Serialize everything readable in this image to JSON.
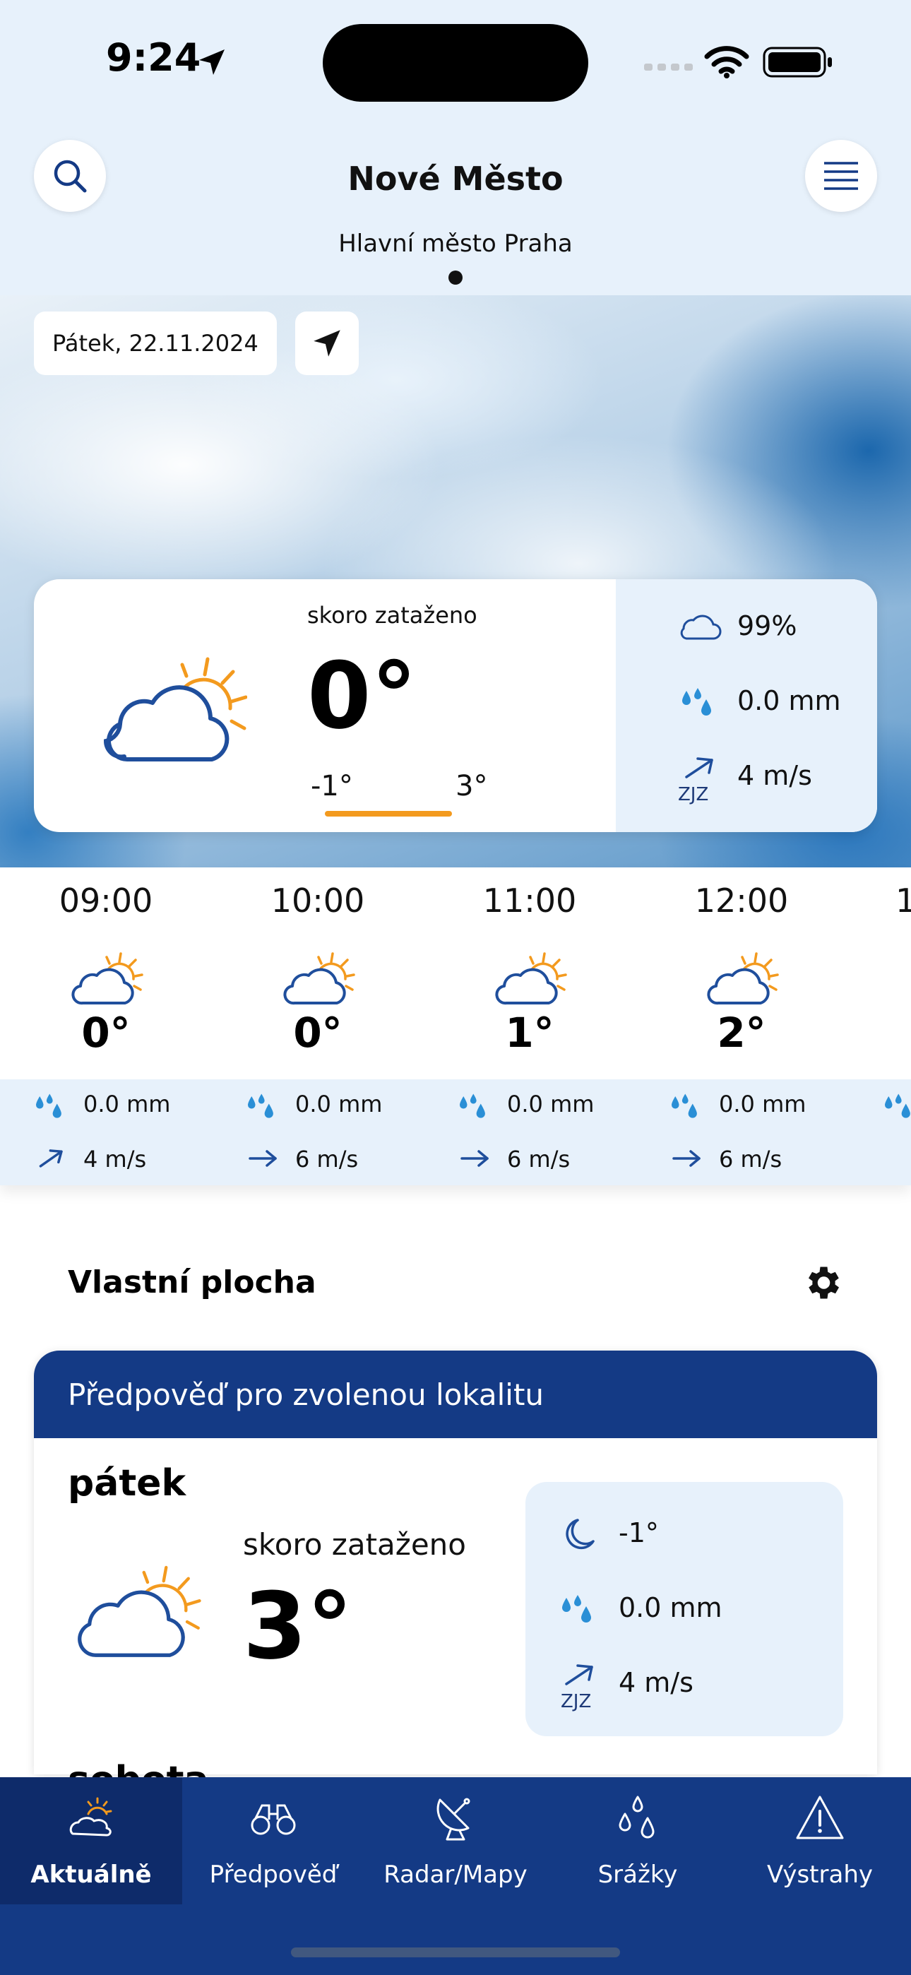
{
  "status_bar": {
    "time": "9:24"
  },
  "header": {
    "city": "Nové Město",
    "region": "Hlavní město Praha"
  },
  "date": "Pátek, 22.11.2024",
  "current": {
    "condition": "skoro zataženo",
    "temperature": "0°",
    "min": "-1°",
    "max": "3°",
    "cloudiness": "99%",
    "precipitation": "0.0 mm",
    "wind_dir": "ZJZ",
    "wind": "4 m/s"
  },
  "hourly": [
    {
      "time": "09:00",
      "temp": "0°",
      "precip": "0.0 mm",
      "wind": "4 m/s"
    },
    {
      "time": "10:00",
      "temp": "0°",
      "precip": "0.0 mm",
      "wind": "6 m/s"
    },
    {
      "time": "11:00",
      "temp": "1°",
      "precip": "0.0 mm",
      "wind": "6 m/s"
    },
    {
      "time": "12:00",
      "temp": "2°",
      "precip": "0.0 mm",
      "wind": "6 m/s"
    }
  ],
  "custom_panel": {
    "title": "Vlastní plocha",
    "card_header": "Předpověď pro zvolenou lokalitu",
    "day": "pátek",
    "condition": "skoro zataženo",
    "temperature": "3°",
    "night_temp": "-1°",
    "precipitation": "0.0 mm",
    "wind_dir": "ZJZ",
    "wind": "4 m/s",
    "next_day": "sobota"
  },
  "tabs": [
    {
      "label": "Aktuálně",
      "icon": "cloud-sun-icon"
    },
    {
      "label": "Předpověď",
      "icon": "binoculars-icon"
    },
    {
      "label": "Radar/Mapy",
      "icon": "radar-dish-icon"
    },
    {
      "label": "Srážky",
      "icon": "raindrops-icon"
    },
    {
      "label": "Výstrahy",
      "icon": "warning-icon"
    }
  ],
  "colors": {
    "navy": "#143a85",
    "light_blue": "#e7f1fb",
    "orange": "#f39a1e"
  }
}
